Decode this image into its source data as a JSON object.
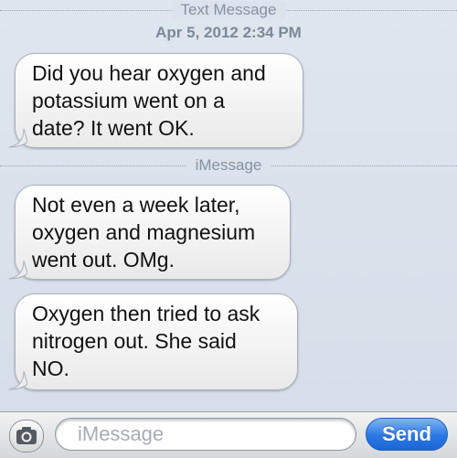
{
  "thread": {
    "service_label_sms": "Text Message",
    "timestamp": "Apr 5, 2012 2:34 PM",
    "service_label_imessage": "iMessage",
    "messages": [
      {
        "text": "Did you hear oxygen and\npotassium went on a\ndate? It went OK."
      },
      {
        "text": "Not even a week later,\noxygen and magnesium\nwent out. OMg."
      },
      {
        "text": "Oxygen then tried to ask\nnitrogen out. She said\nNO."
      }
    ]
  },
  "composer": {
    "placeholder": "iMessage",
    "send_label": "Send"
  },
  "icons": {
    "camera": "camera-icon"
  },
  "colors": {
    "thread_background": "#dfe6ef",
    "bubble": "#ffffff",
    "send_button": "#2a78e4"
  }
}
